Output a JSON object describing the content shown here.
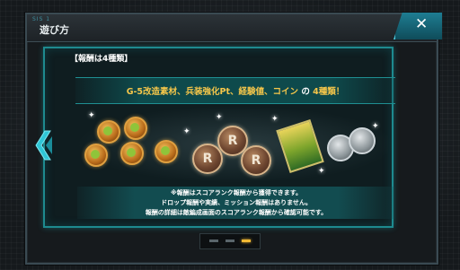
{
  "window": {
    "title": "遊び方",
    "code": "SIS 1",
    "close_icon": "close-icon"
  },
  "panel": {
    "section_label": "【報酬は4種類】",
    "headline": {
      "highlight": "G-5改造素材、兵装強化Pt、経験値、コイン",
      "particle": " の ",
      "tail": "4種類！"
    },
    "items": [
      {
        "icon": "modification-material-icon"
      },
      {
        "icon": "weapon-enhance-coin-icon"
      },
      {
        "icon": "experience-item-icon"
      },
      {
        "icon": "coin-icon"
      }
    ],
    "coin_glyph": "R",
    "notes": [
      "※報酬はスコアランク報酬から獲得できます。",
      "ドロップ報酬や実績、ミッション報酬はありません。",
      "報酬の詳細は敵編成画面のスコアランク報酬から確認可能です。"
    ]
  },
  "nav": {
    "prev_icon": "chevron-left-icon"
  },
  "pager": {
    "page_count": 3,
    "active_page": 3
  },
  "colors": {
    "accent": "#1e8a8f",
    "headline_gold": "#f5c64a",
    "close_button": "#1e7d92",
    "pager_active": "#f2b934"
  }
}
